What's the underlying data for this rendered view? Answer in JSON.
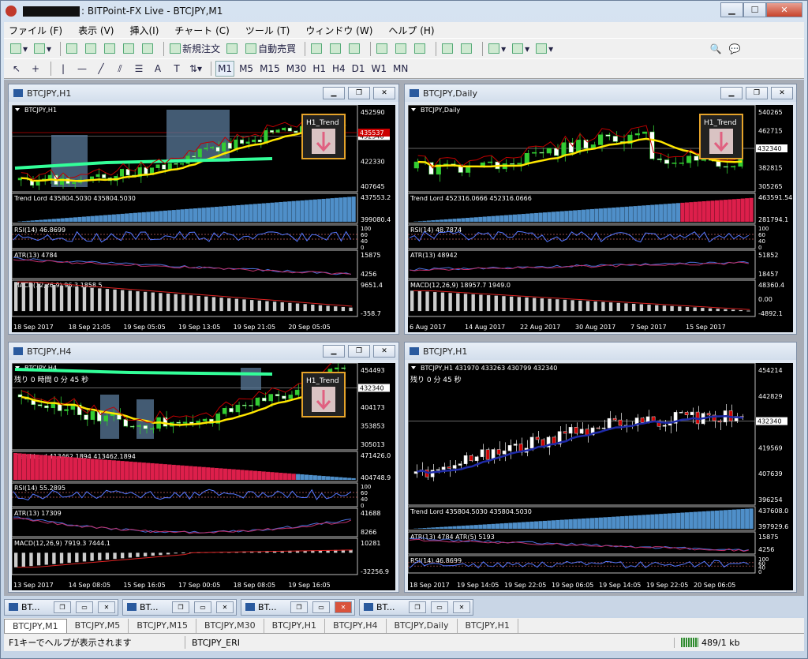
{
  "window": {
    "title": ": BITPoint-FX Live - BTCJPY,M1"
  },
  "menu": [
    "ファイル (F)",
    "表示 (V)",
    "挿入(I)",
    "チャート (C)",
    "ツール (T)",
    "ウィンドウ (W)",
    "ヘルプ (H)"
  ],
  "toolbar": {
    "new_order": "新規注文",
    "auto_trade": "自動売買"
  },
  "timeframes": [
    "M1",
    "M5",
    "M15",
    "M30",
    "H1",
    "H4",
    "D1",
    "W1",
    "MN"
  ],
  "charts": [
    {
      "title": "BTCJPY,H1",
      "symbol": "BTCJPY,H1",
      "trend_label": "H1_Trend",
      "price_ticks": [
        "452590",
        "432340",
        "422330",
        "407645"
      ],
      "current_price": "432340",
      "red_price": "435537",
      "trend_lord": "Trend Lord 435804.5030 435804.5030",
      "tl_ticks": [
        "437553.2",
        "399080.4"
      ],
      "rsi": "RSI(14) 46.8699",
      "rsi_ticks": [
        "100",
        "60",
        "40",
        "0"
      ],
      "atr": "ATR(13) 4784",
      "atr_ticks": [
        "15875",
        "4256"
      ],
      "macd": "MACD(12,26,9) 96.3 1858.5",
      "macd_ticks": [
        "9651.4",
        "-358.7"
      ],
      "dates": [
        "18 Sep 2017",
        "18 Sep 21:05",
        "19 Sep 05:05",
        "19 Sep 13:05",
        "19 Sep 21:05",
        "20 Sep 05:05"
      ]
    },
    {
      "title": "BTCJPY,Daily",
      "symbol": "BTCJPY,Daily",
      "trend_label": "H1_Trend",
      "price_ticks": [
        "540265",
        "462715",
        "432340",
        "382815",
        "305265"
      ],
      "current_price": "432340",
      "trend_lord": "Trend Lord 452316.0666 452316.0666",
      "tl_ticks": [
        "463591.54",
        "281794.1"
      ],
      "rsi": "RSI(14) 48.7874",
      "rsi_ticks": [
        "100",
        "60",
        "40",
        "0"
      ],
      "atr": "ATR(13) 48942",
      "atr_ticks": [
        "51852",
        "18457"
      ],
      "macd": "MACD(12,26,9) 18957.7 1949.0",
      "macd_ticks": [
        "48360.4",
        "0.00",
        "-4892.1"
      ],
      "dates": [
        "6 Aug 2017",
        "14 Aug 2017",
        "22 Aug 2017",
        "30 Aug 2017",
        "7 Sep 2017",
        "15 Sep 2017"
      ]
    },
    {
      "title": "BTCJPY,H4",
      "symbol": "BTCJPY,H4",
      "trend_label": "H1_Trend",
      "overlay": "残り 0 時間 0 分 45 秒",
      "price_ticks": [
        "454493",
        "432340",
        "404173",
        "353853",
        "305013"
      ],
      "current_price": "432340",
      "trend_lord": "Trend Lord 413462.1894 413462.1894",
      "tl_ticks": [
        "471426.0",
        "404748.9"
      ],
      "rsi": "RSI(14) 55.2895",
      "rsi_ticks": [
        "100",
        "60",
        "40",
        "0"
      ],
      "atr": "ATR(13) 17309",
      "atr_ticks": [
        "41688",
        "8266"
      ],
      "macd": "MACD(12,26,9) 7919.3 7444.1",
      "macd_ticks": [
        "10281",
        "-32256.9"
      ],
      "dates": [
        "13 Sep 2017",
        "14 Sep 08:05",
        "15 Sep 16:05",
        "17 Sep 00:05",
        "18 Sep 08:05",
        "19 Sep 16:05"
      ]
    },
    {
      "title": "BTCJPY,H1",
      "symbol": "BTCJPY,H1  431970 433263 430799 432340",
      "overlay": "残り 0 分 45 秒",
      "price_ticks": [
        "454214",
        "442829",
        "432340",
        "419569",
        "407639",
        "396254"
      ],
      "current_price": "432340",
      "trend_lord": "Trend Lord 435804.5030 435804.5030",
      "tl_ticks": [
        "437608.0",
        "397929.6"
      ],
      "atr": "ATR(13) 4784  ATR(5) 5193",
      "atr_ticks": [
        "15875",
        "4256"
      ],
      "rsi": "RSI(14) 46.8699",
      "rsi_ticks": [
        "100",
        "60",
        "40",
        "0"
      ],
      "dates": [
        "18 Sep 2017",
        "19 Sep 14:05",
        "19 Sep 22:05",
        "19 Sep 06:05",
        "19 Sep 14:05",
        "19 Sep 22:05",
        "20 Sep 06:05"
      ]
    }
  ],
  "task_tabs": [
    "BT...",
    "BT...",
    "BT...",
    "BT..."
  ],
  "symbol_tabs": [
    "BTCJPY,M1",
    "BTCJPY,M5",
    "BTCJPY,M15",
    "BTCJPY,M30",
    "BTCJPY,H1",
    "BTCJPY,H4",
    "BTCJPY,Daily",
    "BTCJPY,H1"
  ],
  "status": {
    "help": "F1キーでヘルプが表示されます",
    "profile": "BTCJPY_ERI",
    "traffic": "489/1 kb"
  },
  "colors": {
    "trend_up": "#4f8fc9",
    "trend_down": "#dd1f4b",
    "sma": "#ffe600",
    "band": "#33ff99",
    "price_line": "#c00000",
    "rsi": "#5577ff",
    "macd": "#cccccc"
  }
}
